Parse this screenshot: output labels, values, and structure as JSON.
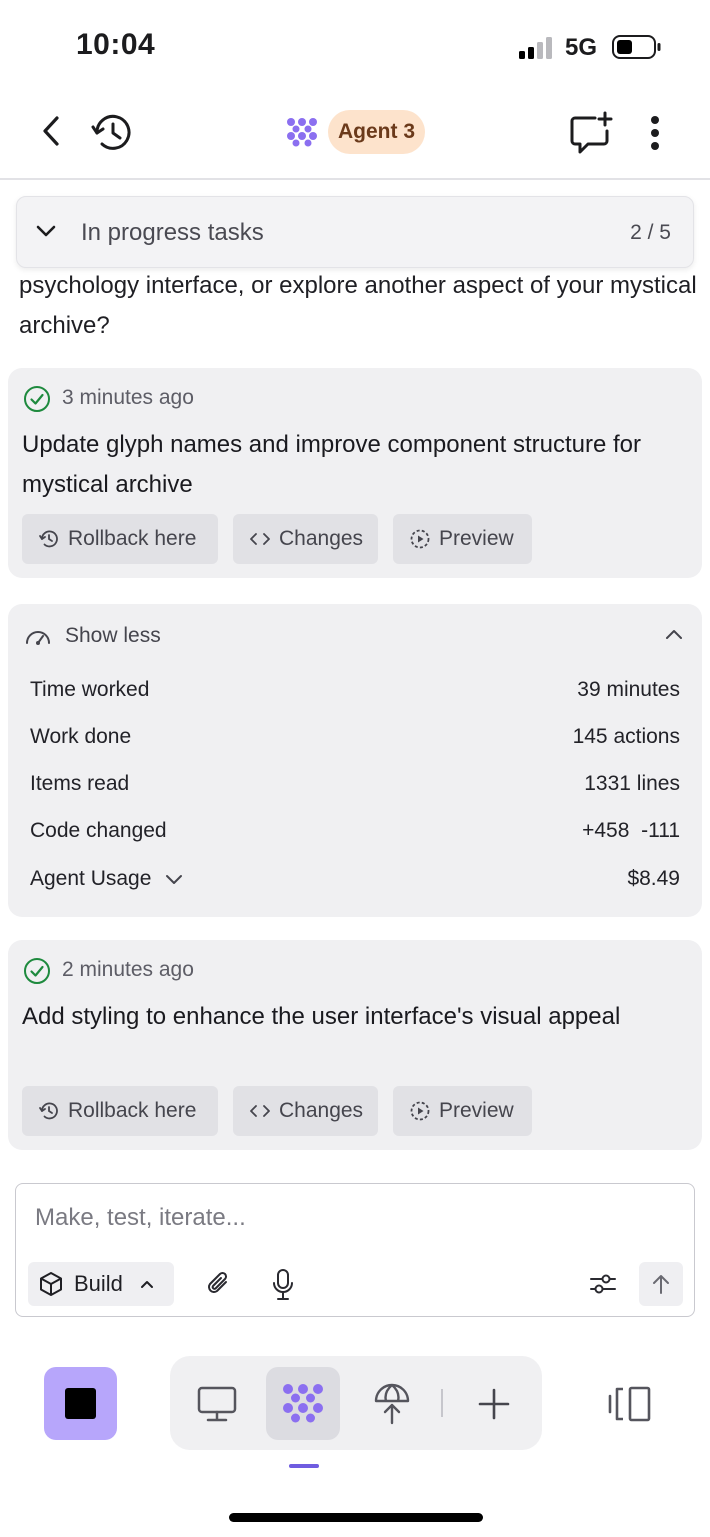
{
  "status_bar": {
    "time": "10:04",
    "network": "5G"
  },
  "header": {
    "agent_label": "Agent 3"
  },
  "progress_banner": {
    "label": "In progress tasks",
    "count": "2 / 5"
  },
  "chat": {
    "text": "psychology interface, or explore another aspect of your mystical archive?"
  },
  "checkpoint_1": {
    "time": "3 minutes ago",
    "message": "Update glyph names and improve component structure for mystical archive",
    "rollback_label": "Rollback here",
    "changes_label": "Changes",
    "preview_label": "Preview"
  },
  "stats": {
    "toggle_label": "Show less",
    "rows": [
      {
        "label": "Time worked",
        "value": "39 minutes"
      },
      {
        "label": "Work done",
        "value": "145 actions"
      },
      {
        "label": "Items read",
        "value": "1331 lines"
      },
      {
        "label": "Code changed",
        "value": "+458  -111"
      },
      {
        "label": "Agent Usage",
        "value": "$8.49"
      }
    ]
  },
  "checkpoint_2": {
    "time": "2 minutes ago",
    "message": "Add styling to enhance the user interface's visual appeal",
    "rollback_label": "Rollback here",
    "changes_label": "Changes",
    "preview_label": "Preview"
  },
  "composer": {
    "placeholder": "Make, test, iterate...",
    "mode_label": "Build"
  },
  "colors": {
    "accent": "#b7a6fb",
    "agent_pill": "#fde3cc",
    "check_green": "#1e8a3e",
    "nav_indicator": "#6f5ce0"
  }
}
